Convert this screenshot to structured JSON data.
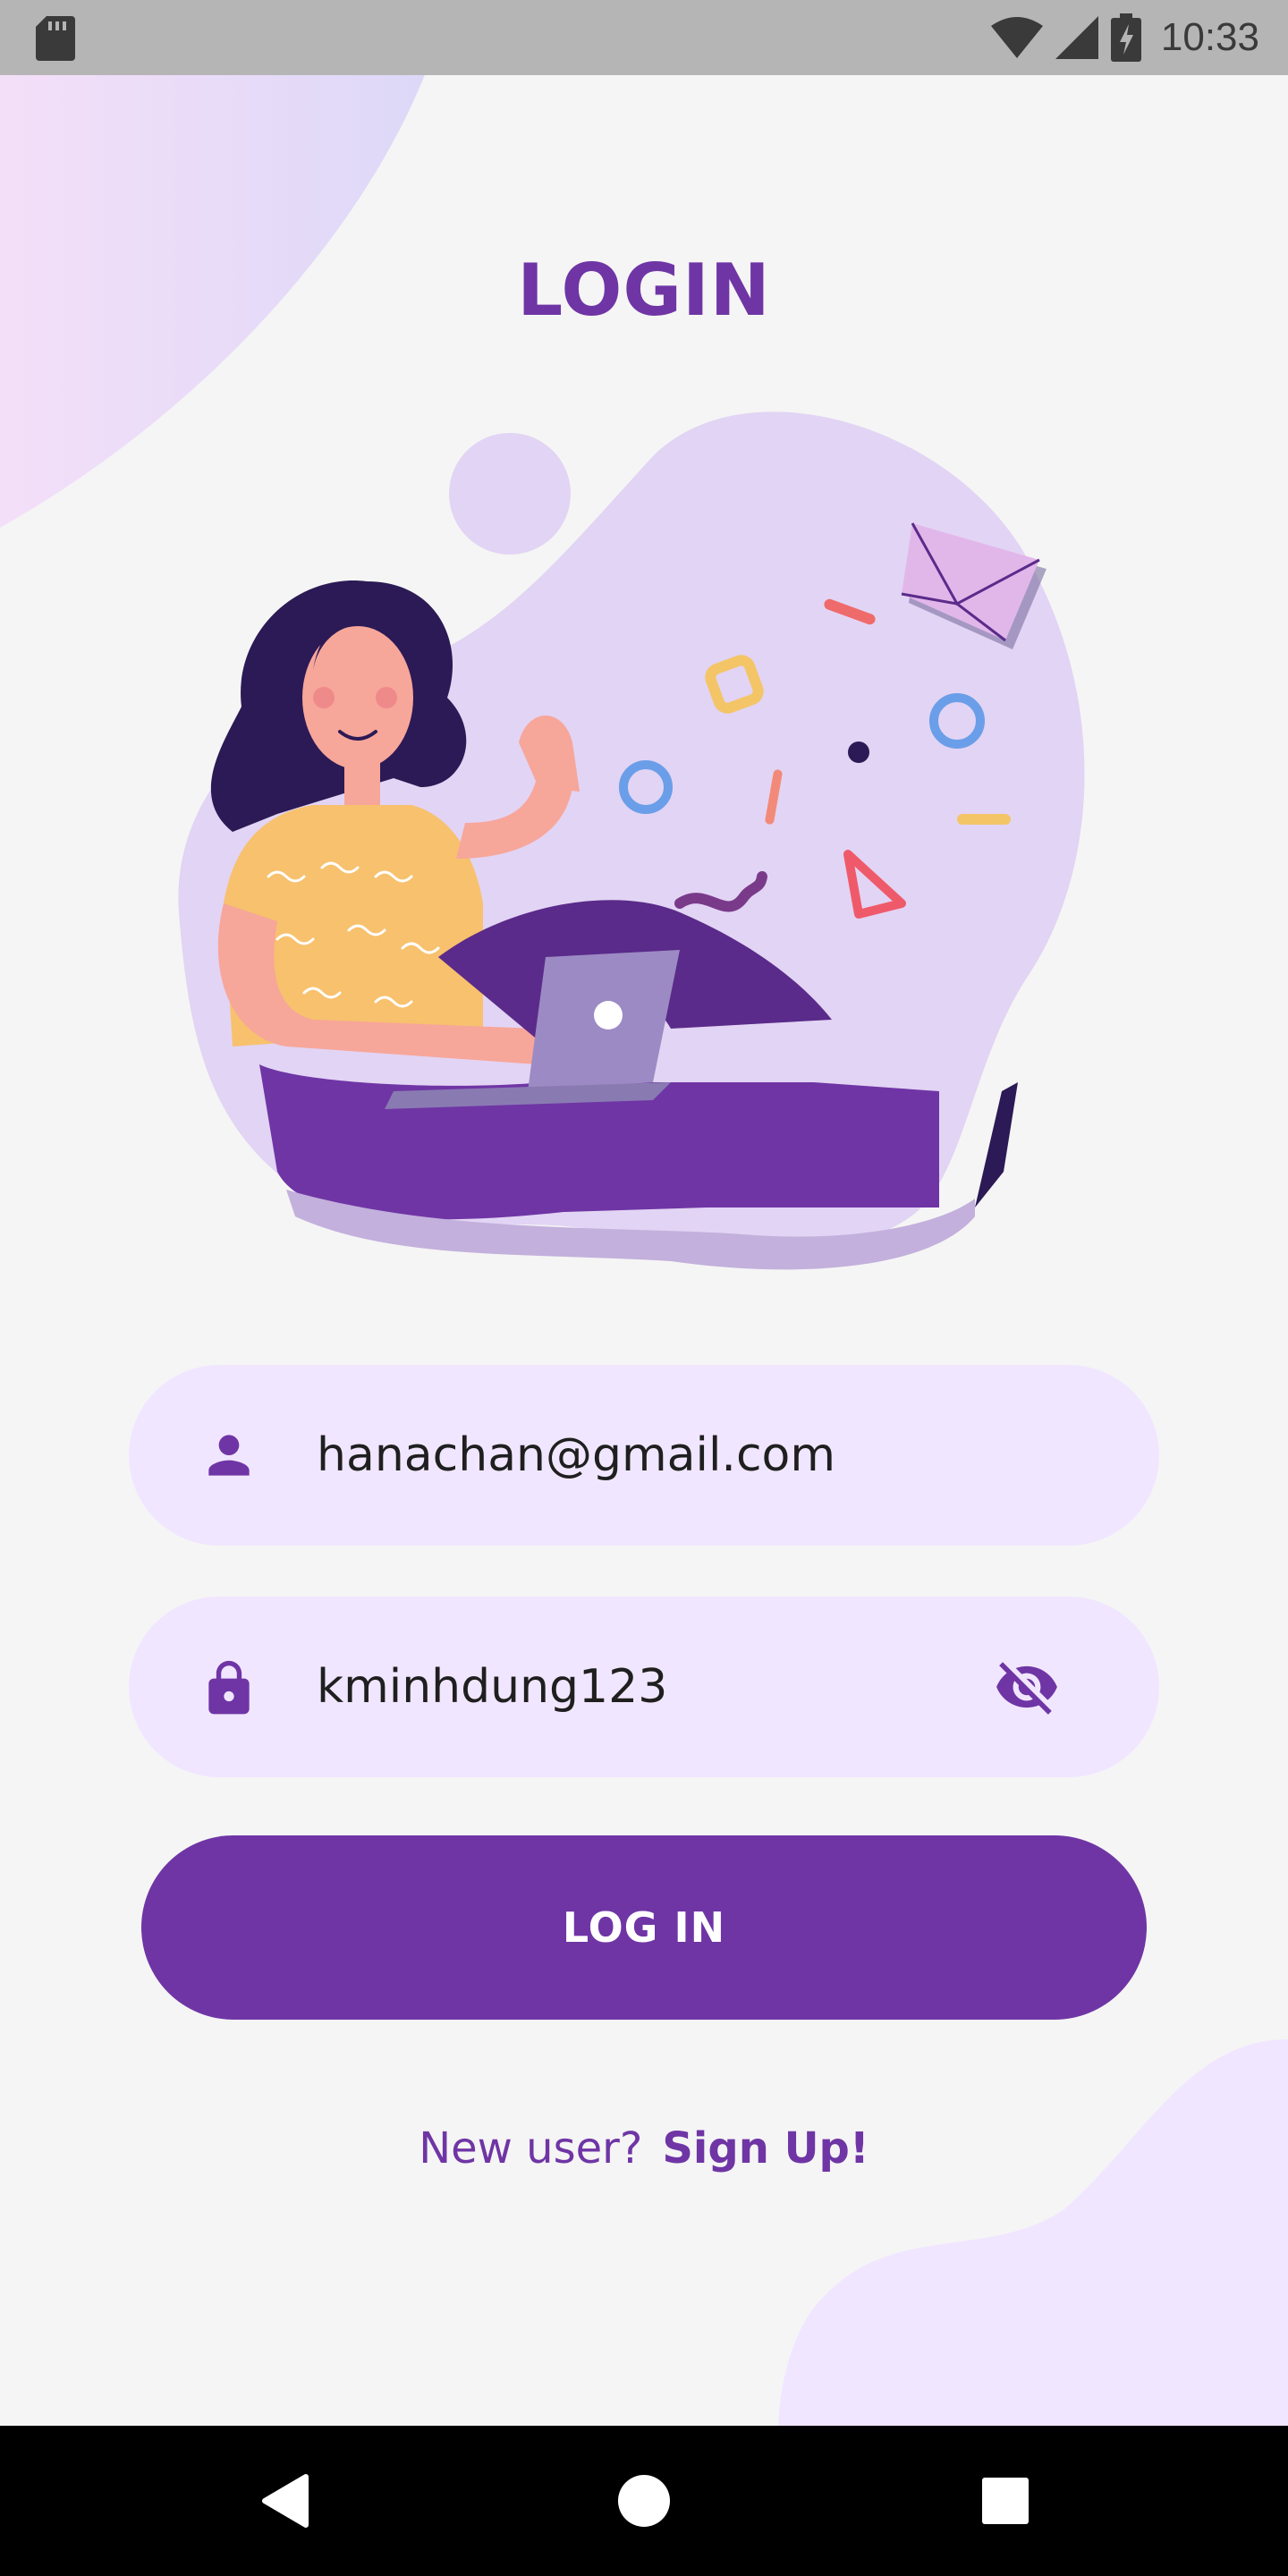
{
  "status_bar": {
    "time": "10:33",
    "icons": [
      "sd-card-icon",
      "wifi-icon",
      "signal-icon",
      "battery-charging-icon"
    ]
  },
  "screen": {
    "title": "LOGIN"
  },
  "form": {
    "email": {
      "icon": "person-icon",
      "value": "hanachan@gmail.com"
    },
    "password": {
      "icon": "lock-icon",
      "value": "kminhdung123",
      "toggle_icon": "visibility-off-icon"
    },
    "login_button_label": "LOG IN",
    "signup_prompt": "New user?",
    "signup_link": "Sign Up!"
  },
  "colors": {
    "primary": "#6f35a5",
    "field_background": "#f1e6ff",
    "page_background": "#f5f5f5"
  },
  "nav_bar": {
    "icons": [
      "back-icon",
      "home-icon",
      "recents-icon"
    ]
  }
}
